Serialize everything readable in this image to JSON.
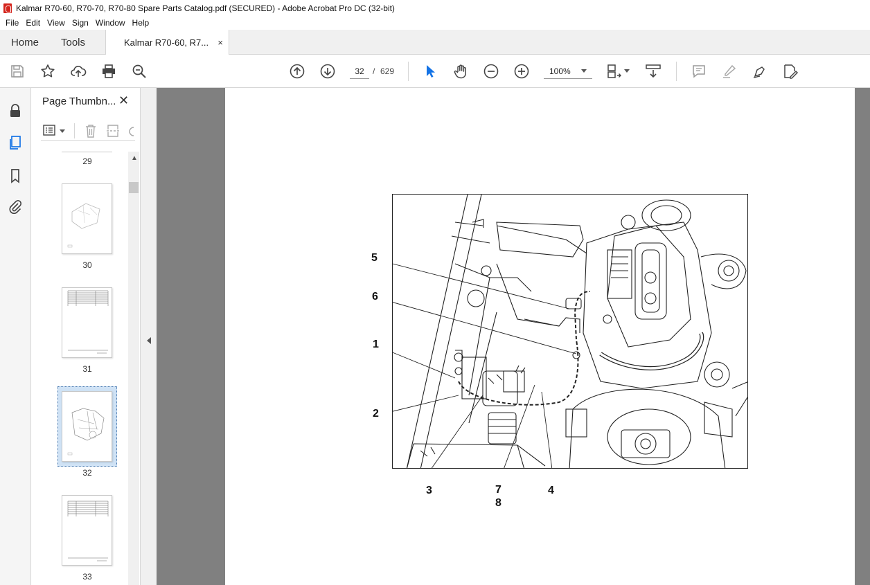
{
  "window": {
    "title": "Kalmar R70-60, R70-70, R70-80 Spare Parts Catalog.pdf (SECURED) - Adobe Acrobat Pro DC (32-bit)"
  },
  "menu": [
    "File",
    "Edit",
    "View",
    "Sign",
    "Window",
    "Help"
  ],
  "tabs": {
    "home": "Home",
    "tools": "Tools",
    "document": "Kalmar R70-60, R7...",
    "close": "×"
  },
  "toolbar": {
    "current_page": "32",
    "page_separator": "/",
    "total_pages": "629",
    "zoom": "100%"
  },
  "thumbnails": {
    "title": "Page Thumbn...",
    "close": "✕",
    "pages": [
      "29",
      "30",
      "31",
      "32",
      "33"
    ],
    "selected_page": "32"
  },
  "figure": {
    "callouts": [
      "5",
      "6",
      "1",
      "2",
      "3",
      "7",
      "8",
      "4"
    ]
  },
  "colors": {
    "accent": "#1473e6",
    "acrobat_red": "#d4241c",
    "doc_background": "#808080"
  }
}
